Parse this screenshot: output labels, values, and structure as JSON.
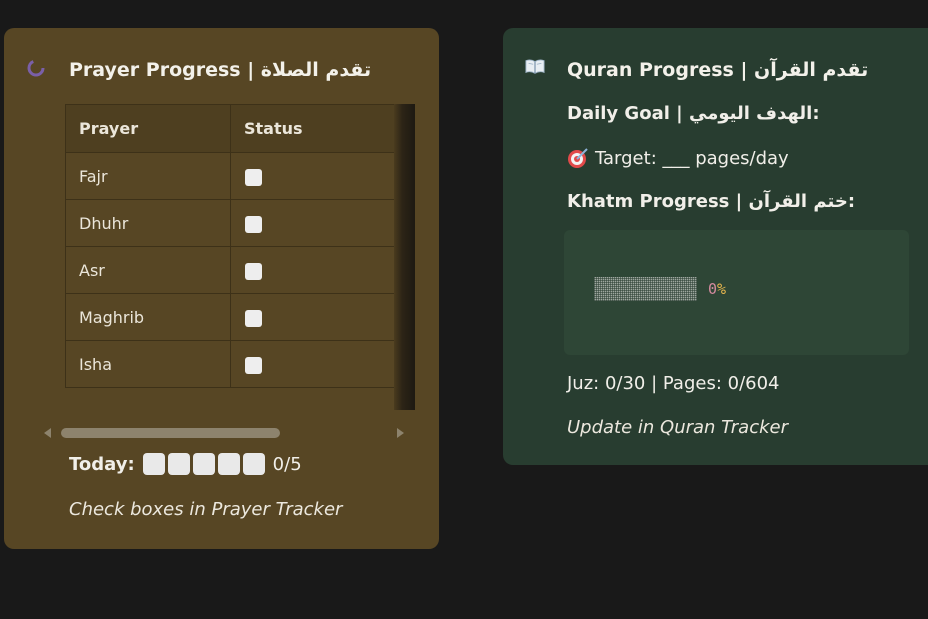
{
  "prayer_card": {
    "title": "Prayer Progress | تقدم الصلاة",
    "icon": "spinner-icon",
    "table": {
      "headers": [
        "Prayer",
        "Status"
      ],
      "rows": [
        {
          "prayer": "Fajr",
          "checked": false
        },
        {
          "prayer": "Dhuhr",
          "checked": false
        },
        {
          "prayer": "Asr",
          "checked": false
        },
        {
          "prayer": "Maghrib",
          "checked": false
        },
        {
          "prayer": "Isha",
          "checked": false
        }
      ]
    },
    "today_label": "Today:",
    "today_count": "0/5",
    "note": "Check boxes in Prayer Tracker"
  },
  "quran_card": {
    "title": "Quran Progress | تقدم القرآن",
    "icon": "book-icon",
    "daily_goal_label": "Daily Goal | الهدف اليومي:",
    "target_text": "Target: ___ pages/day",
    "target_icon": "target-icon",
    "khatm_label": "Khatm Progress | ختم القرآن:",
    "progress_value": 0,
    "progress_digit": "0",
    "progress_symbol": "%",
    "stats": "Juz: 0/30 | Pages: 0/604",
    "note": "Update in Quran Tracker"
  },
  "colors": {
    "prayer_card_bg": "#574624",
    "quran_card_bg": "#283d30",
    "page_bg": "#191919",
    "percent_accent": "#e6b54e"
  }
}
